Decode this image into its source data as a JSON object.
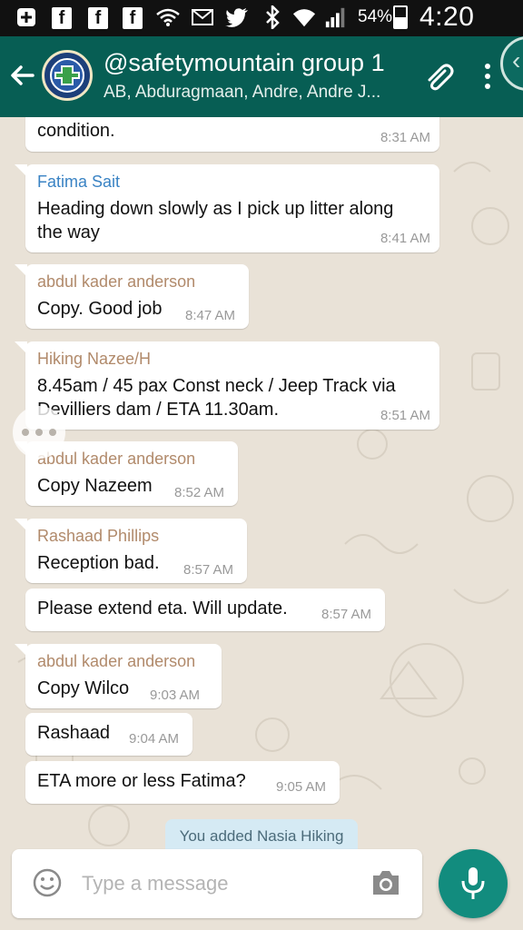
{
  "status_bar": {
    "battery": "54%",
    "time": "4:20 PM",
    "icons": [
      "add-icon",
      "facebook-icon",
      "facebook-icon",
      "facebook-icon",
      "wifi-icon",
      "mail-icon",
      "twitter-icon",
      "bluetooth-icon",
      "wifi-signal-icon",
      "cell-signal-icon",
      "battery-icon"
    ]
  },
  "header": {
    "title": "@safetymountain group 1",
    "subtitle": "AB, Abduragmaan, Andre, Andre J..."
  },
  "messages": [
    {
      "sender": "",
      "lines": [
        "condition."
      ],
      "time": "8:31 AM"
    },
    {
      "sender": "Fatima Sait",
      "sender_color": "#3a83c4",
      "lines": [
        "Heading down slowly as I pick up litter along",
        "the way"
      ],
      "time": "8:41 AM"
    },
    {
      "sender": "abdul kader anderson",
      "sender_color": "#b18a6b",
      "lines": [
        "Copy. Good job"
      ],
      "time": "8:47 AM"
    },
    {
      "sender": "Hiking Nazee/H",
      "sender_color": "#b18a6b",
      "lines": [
        "8.45am / 45 pax Const neck / Jeep Track via",
        "Devilliers dam / ETA  11.30am."
      ],
      "time": "8:51 AM"
    },
    {
      "sender": "abdul kader anderson",
      "sender_color": "#b18a6b",
      "lines": [
        "Copy Nazeem"
      ],
      "time": "8:52 AM"
    },
    {
      "sender": "Rashaad Phillips",
      "sender_color": "#b18a6b",
      "lines": [
        "Reception bad."
      ],
      "time": "8:57 AM"
    },
    {
      "sender": "",
      "lines": [
        "Please extend eta. Will update."
      ],
      "time": "8:57 AM"
    },
    {
      "sender": "abdul kader anderson",
      "sender_color": "#b18a6b",
      "lines": [
        "Copy Wilco"
      ],
      "time": "9:03 AM"
    },
    {
      "sender": "",
      "lines": [
        "Rashaad"
      ],
      "time": "9:04 AM"
    },
    {
      "sender": "",
      "lines": [
        "ETA more or less Fatima?"
      ],
      "time": "9:05 AM"
    }
  ],
  "system_message": "You added Nasia Hiking",
  "input": {
    "placeholder": "Type a message"
  },
  "colors": {
    "header": "#075e54",
    "accent": "#128c7e",
    "chat_bg": "#e9e2d7"
  }
}
